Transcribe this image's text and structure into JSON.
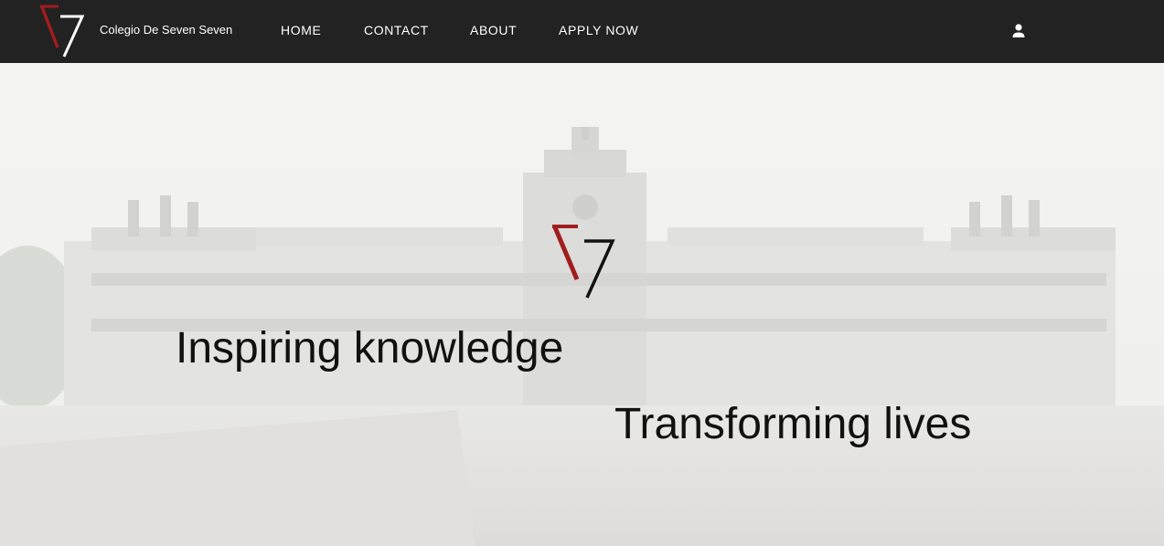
{
  "brand": {
    "name": "Colegio De Seven Seven",
    "logo_icon": "v7-logo-icon",
    "accent_color": "#9b1c1c"
  },
  "nav": {
    "items": [
      {
        "label": "HOME"
      },
      {
        "label": "CONTACT"
      },
      {
        "label": "ABOUT"
      },
      {
        "label": "APPLY NOW"
      }
    ],
    "account_icon": "user-icon",
    "background": "#222222"
  },
  "hero": {
    "logo_icon": "v7-logo-icon",
    "background_image": "university-building-photo",
    "tagline_primary": "Inspiring knowledge",
    "tagline_secondary": "Transforming lives"
  }
}
